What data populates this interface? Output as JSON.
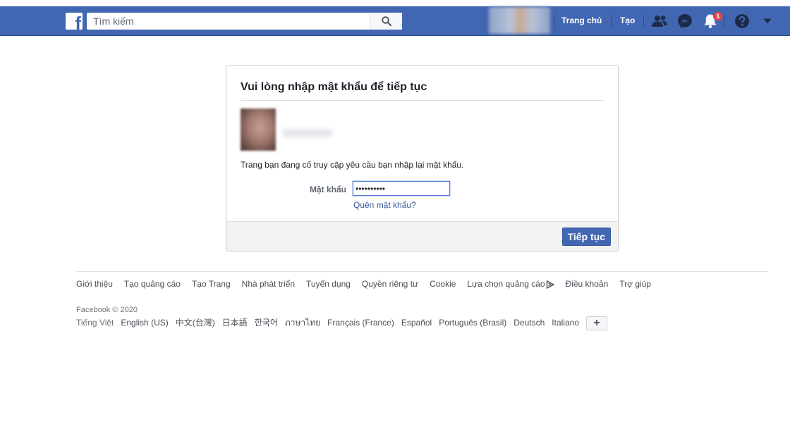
{
  "header": {
    "search_placeholder": "Tìm kiếm",
    "home_label": "Trang chủ",
    "create_label": "Tạo",
    "notification_count": "1",
    "brand_color": "#4267b2"
  },
  "dialog": {
    "title": "Vui lòng nhập mật khẩu để tiếp tục",
    "message": "Trang bạn đang cố truy cập yêu cầu bạn nhập lại mật khẩu.",
    "password_label": "Mật khẩu",
    "password_value": "••••••••••",
    "forgot_link": "Quên mật khẩu?",
    "continue_button": "Tiếp tục"
  },
  "footer": {
    "links": [
      "Giới thiệu",
      "Tạo quảng cáo",
      "Tạo Trang",
      "Nhà phát triển",
      "Tuyển dụng",
      "Quyền riêng tư",
      "Cookie",
      "Lựa chọn quảng cáo",
      "Điều khoản",
      "Trợ giúp"
    ],
    "copyright": "Facebook © 2020",
    "current_language": "Tiếng Việt",
    "languages": [
      "English (US)",
      "中文(台灣)",
      "日本語",
      "한국어",
      "ภาษาไทย",
      "Français (France)",
      "Español",
      "Português (Brasil)",
      "Deutsch",
      "Italiano"
    ],
    "more_languages_symbol": "+"
  },
  "icons": {
    "logo": "facebook-logo-icon",
    "search": "search-icon",
    "friends": "friend-requests-icon",
    "messenger": "messenger-icon",
    "notifications": "notifications-bell-icon",
    "help": "help-icon",
    "menu": "account-menu-caret-icon",
    "adchoices": "adchoices-icon"
  }
}
